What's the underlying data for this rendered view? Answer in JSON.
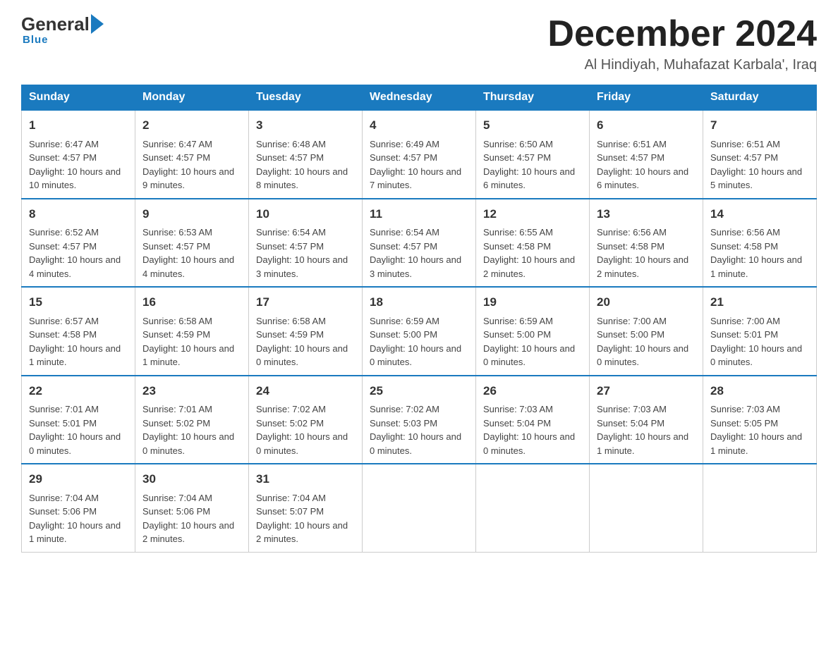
{
  "logo": {
    "general": "General",
    "blue": "Blue",
    "tagline": "Blue"
  },
  "header": {
    "title": "December 2024",
    "subtitle": "Al Hindiyah, Muhafazat Karbala', Iraq"
  },
  "weekdays": [
    "Sunday",
    "Monday",
    "Tuesday",
    "Wednesday",
    "Thursday",
    "Friday",
    "Saturday"
  ],
  "weeks": [
    [
      {
        "day": "1",
        "sunrise": "6:47 AM",
        "sunset": "4:57 PM",
        "daylight": "10 hours and 10 minutes."
      },
      {
        "day": "2",
        "sunrise": "6:47 AM",
        "sunset": "4:57 PM",
        "daylight": "10 hours and 9 minutes."
      },
      {
        "day": "3",
        "sunrise": "6:48 AM",
        "sunset": "4:57 PM",
        "daylight": "10 hours and 8 minutes."
      },
      {
        "day": "4",
        "sunrise": "6:49 AM",
        "sunset": "4:57 PM",
        "daylight": "10 hours and 7 minutes."
      },
      {
        "day": "5",
        "sunrise": "6:50 AM",
        "sunset": "4:57 PM",
        "daylight": "10 hours and 6 minutes."
      },
      {
        "day": "6",
        "sunrise": "6:51 AM",
        "sunset": "4:57 PM",
        "daylight": "10 hours and 6 minutes."
      },
      {
        "day": "7",
        "sunrise": "6:51 AM",
        "sunset": "4:57 PM",
        "daylight": "10 hours and 5 minutes."
      }
    ],
    [
      {
        "day": "8",
        "sunrise": "6:52 AM",
        "sunset": "4:57 PM",
        "daylight": "10 hours and 4 minutes."
      },
      {
        "day": "9",
        "sunrise": "6:53 AM",
        "sunset": "4:57 PM",
        "daylight": "10 hours and 4 minutes."
      },
      {
        "day": "10",
        "sunrise": "6:54 AM",
        "sunset": "4:57 PM",
        "daylight": "10 hours and 3 minutes."
      },
      {
        "day": "11",
        "sunrise": "6:54 AM",
        "sunset": "4:57 PM",
        "daylight": "10 hours and 3 minutes."
      },
      {
        "day": "12",
        "sunrise": "6:55 AM",
        "sunset": "4:58 PM",
        "daylight": "10 hours and 2 minutes."
      },
      {
        "day": "13",
        "sunrise": "6:56 AM",
        "sunset": "4:58 PM",
        "daylight": "10 hours and 2 minutes."
      },
      {
        "day": "14",
        "sunrise": "6:56 AM",
        "sunset": "4:58 PM",
        "daylight": "10 hours and 1 minute."
      }
    ],
    [
      {
        "day": "15",
        "sunrise": "6:57 AM",
        "sunset": "4:58 PM",
        "daylight": "10 hours and 1 minute."
      },
      {
        "day": "16",
        "sunrise": "6:58 AM",
        "sunset": "4:59 PM",
        "daylight": "10 hours and 1 minute."
      },
      {
        "day": "17",
        "sunrise": "6:58 AM",
        "sunset": "4:59 PM",
        "daylight": "10 hours and 0 minutes."
      },
      {
        "day": "18",
        "sunrise": "6:59 AM",
        "sunset": "5:00 PM",
        "daylight": "10 hours and 0 minutes."
      },
      {
        "day": "19",
        "sunrise": "6:59 AM",
        "sunset": "5:00 PM",
        "daylight": "10 hours and 0 minutes."
      },
      {
        "day": "20",
        "sunrise": "7:00 AM",
        "sunset": "5:00 PM",
        "daylight": "10 hours and 0 minutes."
      },
      {
        "day": "21",
        "sunrise": "7:00 AM",
        "sunset": "5:01 PM",
        "daylight": "10 hours and 0 minutes."
      }
    ],
    [
      {
        "day": "22",
        "sunrise": "7:01 AM",
        "sunset": "5:01 PM",
        "daylight": "10 hours and 0 minutes."
      },
      {
        "day": "23",
        "sunrise": "7:01 AM",
        "sunset": "5:02 PM",
        "daylight": "10 hours and 0 minutes."
      },
      {
        "day": "24",
        "sunrise": "7:02 AM",
        "sunset": "5:02 PM",
        "daylight": "10 hours and 0 minutes."
      },
      {
        "day": "25",
        "sunrise": "7:02 AM",
        "sunset": "5:03 PM",
        "daylight": "10 hours and 0 minutes."
      },
      {
        "day": "26",
        "sunrise": "7:03 AM",
        "sunset": "5:04 PM",
        "daylight": "10 hours and 0 minutes."
      },
      {
        "day": "27",
        "sunrise": "7:03 AM",
        "sunset": "5:04 PM",
        "daylight": "10 hours and 1 minute."
      },
      {
        "day": "28",
        "sunrise": "7:03 AM",
        "sunset": "5:05 PM",
        "daylight": "10 hours and 1 minute."
      }
    ],
    [
      {
        "day": "29",
        "sunrise": "7:04 AM",
        "sunset": "5:06 PM",
        "daylight": "10 hours and 1 minute."
      },
      {
        "day": "30",
        "sunrise": "7:04 AM",
        "sunset": "5:06 PM",
        "daylight": "10 hours and 2 minutes."
      },
      {
        "day": "31",
        "sunrise": "7:04 AM",
        "sunset": "5:07 PM",
        "daylight": "10 hours and 2 minutes."
      },
      null,
      null,
      null,
      null
    ]
  ],
  "labels": {
    "sunrise": "Sunrise:",
    "sunset": "Sunset:",
    "daylight": "Daylight:"
  }
}
